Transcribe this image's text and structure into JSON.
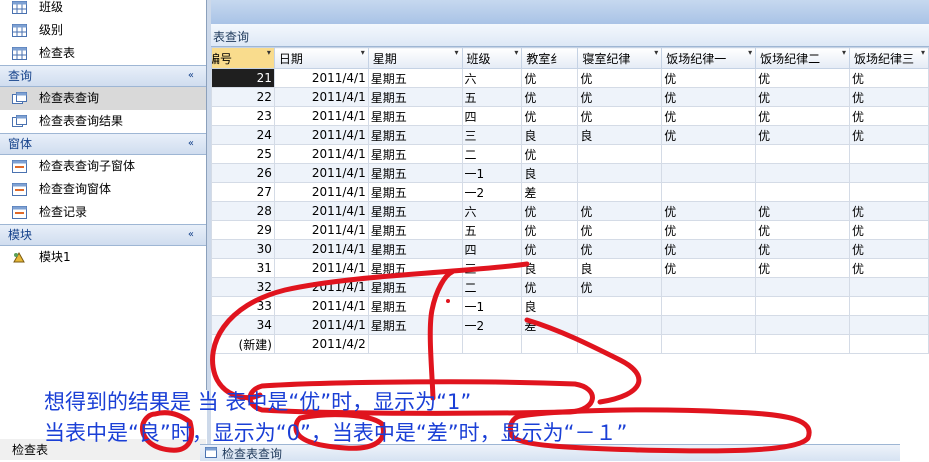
{
  "nav": {
    "top_items": [
      {
        "label": "班级",
        "icon": "table-icon"
      },
      {
        "label": "级别",
        "icon": "table-icon"
      },
      {
        "label": "检查表",
        "icon": "table-icon"
      }
    ],
    "groups": [
      {
        "title": "查询",
        "chevron": "«",
        "items": [
          {
            "label": "检查表查询",
            "icon": "query-icon"
          },
          {
            "label": "检查表查询结果",
            "icon": "query-icon"
          }
        ]
      },
      {
        "title": "窗体",
        "chevron": "«",
        "items": [
          {
            "label": "检查表查询子窗体",
            "icon": "form-icon"
          },
          {
            "label": "检查查询窗体",
            "icon": "form-icon"
          },
          {
            "label": "检查记录",
            "icon": "form-icon"
          }
        ]
      },
      {
        "title": "模块",
        "chevron": "«",
        "items": [
          {
            "label": "模块1",
            "icon": "module-icon"
          }
        ]
      }
    ],
    "bottom_label": "检查表"
  },
  "doc_tab": "表查询",
  "bottom_tab": "检查表查询",
  "columns": [
    "编号",
    "日期",
    "星期",
    "班级",
    "教室纟",
    "寝室纪律",
    "饭场纪律一",
    "饭场纪律二",
    "饭场纪律三"
  ],
  "rows": [
    [
      "21",
      "2011/4/1",
      "星期五",
      "六",
      "优",
      "优",
      "优",
      "优",
      "优"
    ],
    [
      "22",
      "2011/4/1",
      "星期五",
      "五",
      "优",
      "优",
      "优",
      "优",
      "优"
    ],
    [
      "23",
      "2011/4/1",
      "星期五",
      "四",
      "优",
      "优",
      "优",
      "优",
      "优"
    ],
    [
      "24",
      "2011/4/1",
      "星期五",
      "三",
      "良",
      "良",
      "优",
      "优",
      "优"
    ],
    [
      "25",
      "2011/4/1",
      "星期五",
      "二",
      "优",
      "",
      "",
      "",
      ""
    ],
    [
      "26",
      "2011/4/1",
      "星期五",
      "一1",
      "良",
      "",
      "",
      "",
      ""
    ],
    [
      "27",
      "2011/4/1",
      "星期五",
      "一2",
      "差",
      "",
      "",
      "",
      ""
    ],
    [
      "28",
      "2011/4/1",
      "星期五",
      "六",
      "优",
      "优",
      "优",
      "优",
      "优"
    ],
    [
      "29",
      "2011/4/1",
      "星期五",
      "五",
      "优",
      "优",
      "优",
      "优",
      "优"
    ],
    [
      "30",
      "2011/4/1",
      "星期五",
      "四",
      "优",
      "优",
      "优",
      "优",
      "优"
    ],
    [
      "31",
      "2011/4/1",
      "星期五",
      "三",
      "良",
      "良",
      "优",
      "优",
      "优"
    ],
    [
      "32",
      "2011/4/1",
      "星期五",
      "二",
      "优",
      "优",
      "",
      "",
      ""
    ],
    [
      "33",
      "2011/4/1",
      "星期五",
      "一1",
      "良",
      "",
      "",
      "",
      ""
    ],
    [
      "34",
      "2011/4/1",
      "星期五",
      "一2",
      "差",
      "",
      "",
      "",
      ""
    ]
  ],
  "new_row": {
    "label": "(新建)",
    "date": "2011/4/2"
  },
  "annotation": {
    "line1": "想得到的结果是 当 表中是“优”时，显示为“1”",
    "line2": "当表中是“良”时，显示为“0”，当表中是“差”时，显示为“－１”"
  },
  "colors": {
    "selection": "#1f1f1f",
    "key_header": "#f9dc8d",
    "annotation_text": "#1a3fd6",
    "ink": "#e0141e",
    "alt_row": "#eef3fa"
  }
}
